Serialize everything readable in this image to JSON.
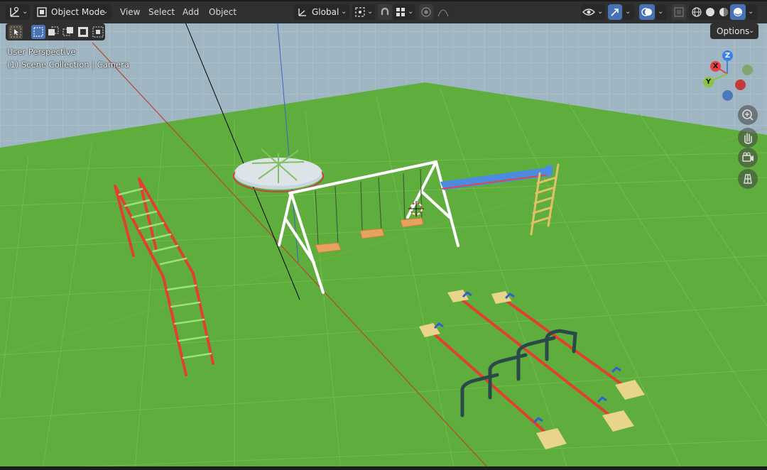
{
  "header": {
    "editor_type_icon": "axes-editor-icon",
    "mode_label": "Object Mode",
    "menus": [
      "View",
      "Select",
      "Add",
      "Object"
    ],
    "transform_orientation": "Global",
    "options_label": "Options"
  },
  "viewport": {
    "view_name": "User Perspective",
    "collection_info": "(1) Scene Collection | Camera"
  },
  "gizmo": {
    "axes": {
      "x": "X",
      "y": "Y",
      "z": "Z"
    },
    "colors": {
      "x": "#e8413f",
      "y": "#8bc53f",
      "z": "#3b82e6"
    }
  },
  "colors": {
    "ground": "#5fae3d",
    "background": "#9db4c0",
    "header": "#303030",
    "active": "#4772b3"
  }
}
